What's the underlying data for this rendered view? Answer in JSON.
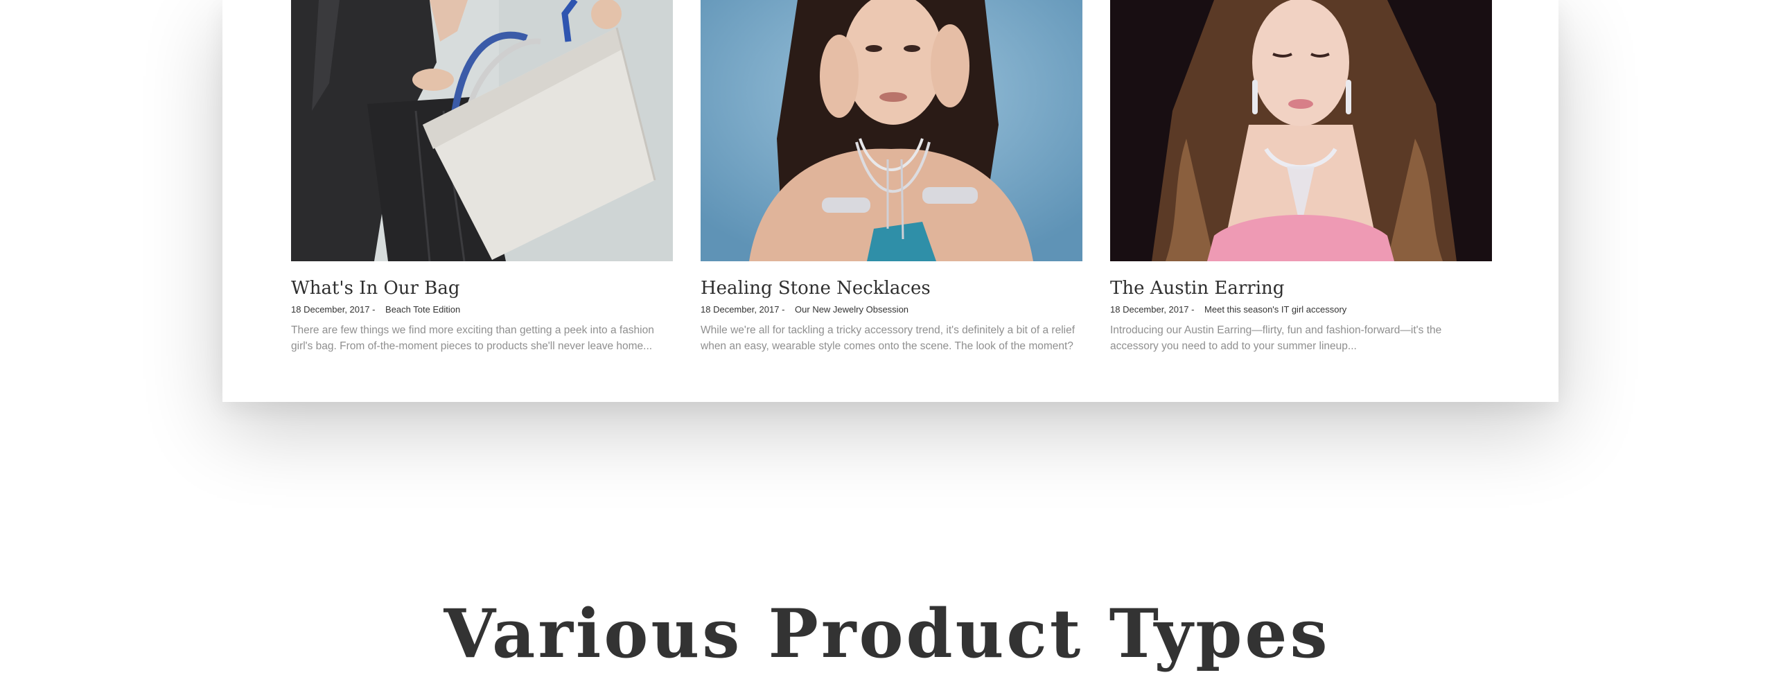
{
  "blog": {
    "posts": [
      {
        "title": "What's In Our Bag",
        "date": "18 December, 2017 -",
        "tag": "Beach Tote Edition",
        "excerpt": "There are few things we find more exciting than getting a peek into a fashion girl's bag. From of-the-moment pieces to products she'll never leave home..."
      },
      {
        "title": "Healing Stone Necklaces",
        "date": "18 December, 2017 -",
        "tag": "Our New Jewelry Obsession",
        "excerpt": "While we're all for tackling a tricky accessory trend, it's definitely a bit of a relief when an easy, wearable style comes onto the scene. The look of the moment?"
      },
      {
        "title": "The Austin Earring",
        "date": "18 December, 2017 -",
        "tag": "Meet this season's IT girl accessory",
        "excerpt": "Introducing our Austin Earring—flirty, fun and fashion-forward—it's the accessory you need to add to your summer lineup..."
      }
    ]
  },
  "section": {
    "title": "Various Product Types"
  },
  "colors": {
    "heading": "#333333",
    "excerpt": "#8f8f8f",
    "panel_shadow": "rgba(0,0,0,0.20)"
  }
}
